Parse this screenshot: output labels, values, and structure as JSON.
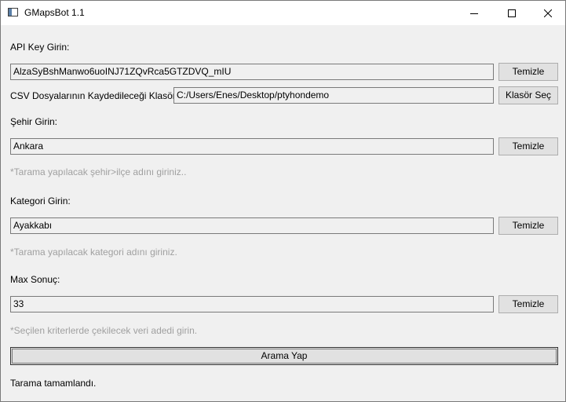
{
  "window": {
    "title": "GMapsBot 1.1",
    "icon": "app-window-icon"
  },
  "api_key": {
    "label": "API Key Girin:",
    "value": "AlzaSyBshManwo6uoINJ71ZQvRca5GTZDVQ_mIU",
    "clear_label": "Temizle"
  },
  "csv_folder": {
    "label": "CSV Dosyalarının Kaydedileceği Klasör:",
    "value": "C:/Users/Enes/Desktop/ptyhondemo",
    "choose_label": "Klasör Seç"
  },
  "city": {
    "label": "Şehir Girin:",
    "value": "Ankara",
    "clear_label": "Temizle",
    "hint": "*Tarama yapılacak şehir>ilçe adını giriniz.."
  },
  "category": {
    "label": "Kategori Girin:",
    "value": "Ayakkabı",
    "clear_label": "Temizle",
    "hint": "*Tarama yapılacak kategori adını giriniz."
  },
  "max_results": {
    "label": "Max Sonuç:",
    "value": "33",
    "clear_label": "Temizle",
    "hint": "*Seçilen kriterlerde çekilecek veri adedi girin."
  },
  "search_button_label": "Arama Yap",
  "status_text": "Tarama tamamlandı.",
  "colors": {
    "window_bg": "#f0f0f0",
    "titlebar_bg": "#ffffff",
    "hint_text": "#a0a0a0",
    "button_bg": "#e1e1e1",
    "border": "#7a7a7a"
  }
}
